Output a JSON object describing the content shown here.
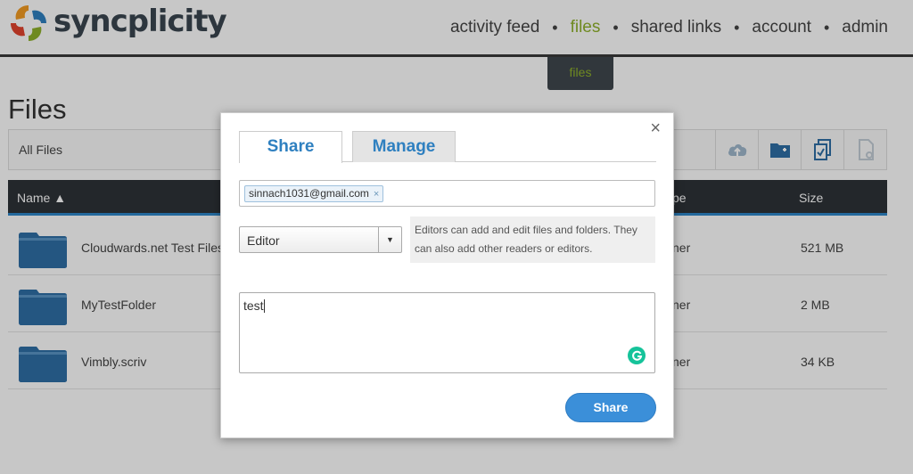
{
  "app": {
    "name": "syncplicity"
  },
  "nav": {
    "items": [
      "activity feed",
      "files",
      "shared links",
      "account",
      "admin"
    ],
    "active": "files",
    "tooltip": "files"
  },
  "page": {
    "title": "Files",
    "breadcrumb": "All Files"
  },
  "toolbar": {
    "icons": [
      "cloud-upload-icon",
      "new-folder-icon",
      "copy-icon",
      "document-icon"
    ]
  },
  "table": {
    "columns": {
      "name": "Name ▲",
      "type": "pe",
      "size": "Size"
    },
    "rows": [
      {
        "name": "Cloudwards.net Test Files",
        "type": "ner",
        "size": "521 MB"
      },
      {
        "name": "MyTestFolder",
        "type": "ner",
        "size": "2 MB"
      },
      {
        "name": "Vimbly.scriv",
        "type": "ner",
        "size": "34 KB"
      }
    ]
  },
  "modal": {
    "close": "×",
    "tabs": {
      "share": "Share",
      "manage": "Manage"
    },
    "email_chip": "sinnach1031@gmail.com",
    "chip_remove": "×",
    "role": "Editor",
    "role_help": "Editors can add and edit files and folders. They can also add other readers or editors.",
    "message": "test",
    "submit": "Share"
  },
  "colors": {
    "accent_green": "#8fb12b",
    "accent_blue": "#3b8fd9",
    "table_header": "#2e3338",
    "folder": "#2f6fa6"
  }
}
